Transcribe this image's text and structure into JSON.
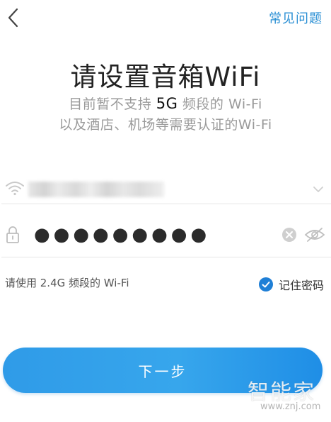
{
  "header": {
    "back_icon": "chevron-left-icon",
    "faq_label": "常见问题"
  },
  "content": {
    "title": "请设置音箱WiFi",
    "subtitle_line1_prefix": "目前暂不支持 ",
    "subtitle_line1_highlight": "5G",
    "subtitle_line1_suffix": " 频段的 Wi-Fi",
    "subtitle_line2": "以及酒店、机场等需要认证的Wi-Fi"
  },
  "wifi_field": {
    "icon": "wifi-icon",
    "ssid": "",
    "dropdown_icon": "chevron-down-icon"
  },
  "password_field": {
    "icon": "lock-icon",
    "value": "●●●●●●●●●",
    "clear_icon": "clear-icon",
    "visibility_icon": "eye-off-icon"
  },
  "hint": "请使用 2.4G 频段的 Wi-Fi",
  "remember": {
    "label": "记住密码",
    "checked": true
  },
  "next_button": {
    "label": "下一步"
  },
  "watermark": {
    "text": "智能家",
    "url": "www.znj.com"
  },
  "colors": {
    "accent": "#2a8fd4",
    "button_gradient_start": "#2f9be8",
    "button_gradient_end": "#1f8ee6",
    "check": "#1f7fd6"
  }
}
